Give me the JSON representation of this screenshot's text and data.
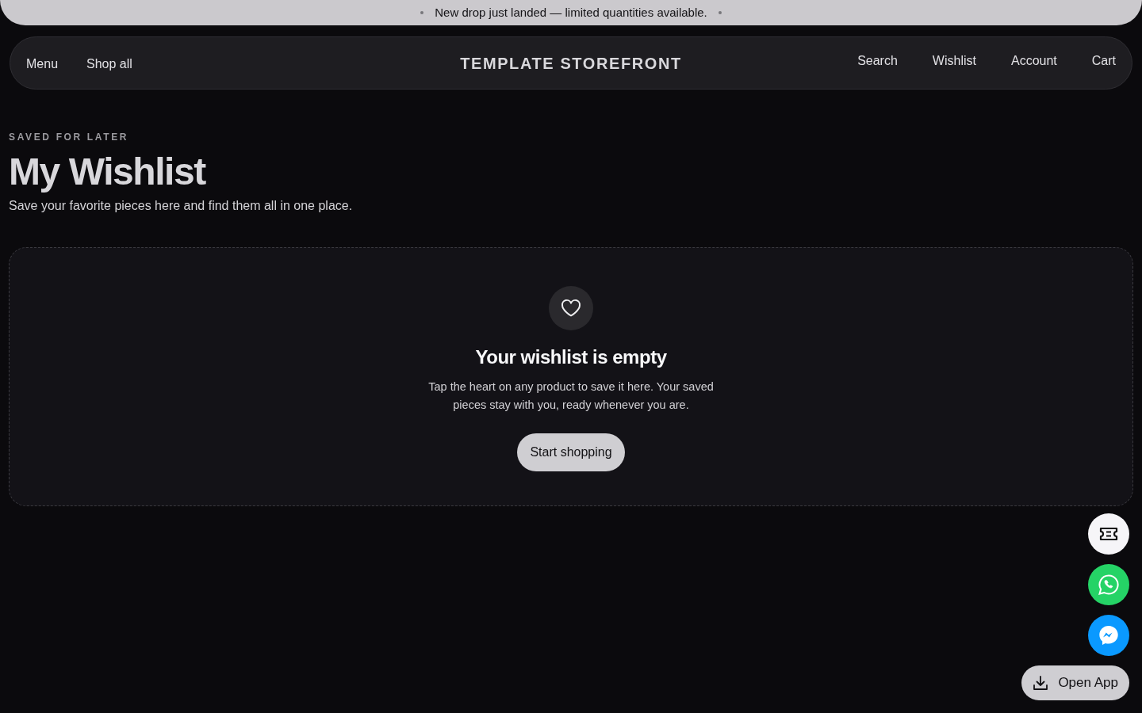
{
  "announcement": {
    "text": "New drop just landed — limited quantities available."
  },
  "nav": {
    "left": [
      "Menu",
      "Shop all"
    ],
    "brand": "TEMPLATE STOREFRONT",
    "right": [
      "Search",
      "Wishlist",
      "Account",
      "Cart"
    ]
  },
  "header": {
    "eyebrow": "SAVED FOR LATER",
    "title": "My Wishlist",
    "subtitle": "Save your favorite pieces here and find them all in one place."
  },
  "empty_state": {
    "title": "Your wishlist is empty",
    "message": "Tap the heart on any product to save it here. Your saved pieces stay with you, ready whenever you are.",
    "button": "Start shopping"
  },
  "floating": {
    "actions": [
      {
        "kind": "ticket"
      },
      {
        "kind": "whatsapp"
      },
      {
        "kind": "messenger"
      }
    ],
    "open_app": "Open App"
  }
}
